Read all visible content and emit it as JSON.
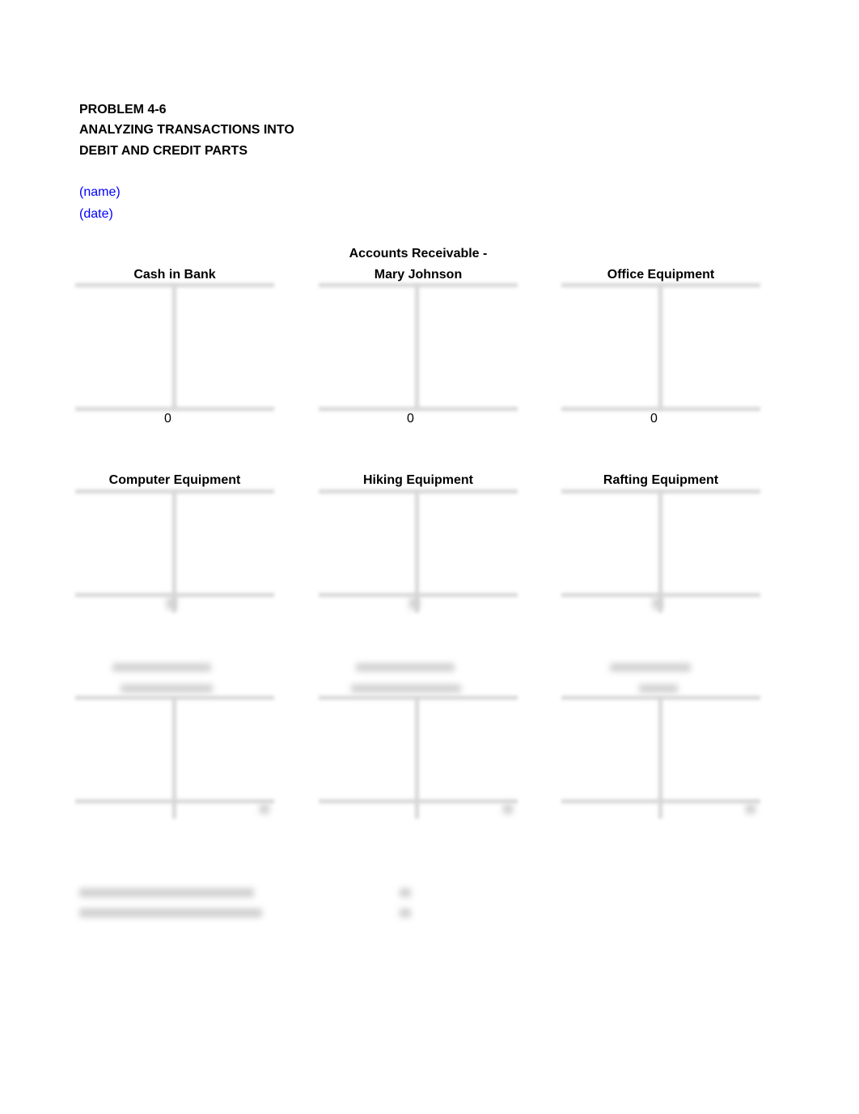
{
  "header": {
    "problem": "PROBLEM 4-6",
    "title_line1": "ANALYZING TRANSACTIONS INTO",
    "title_line2": "DEBIT AND CREDIT PARTS",
    "name_placeholder": "(name)",
    "date_placeholder": "(date)"
  },
  "accounts_row1": [
    {
      "title_line1": "",
      "title_line2": "Cash in Bank",
      "balance": "0"
    },
    {
      "title_line1": "Accounts Receivable -",
      "title_line2": "Mary Johnson",
      "balance": "0"
    },
    {
      "title_line1": "",
      "title_line2": "Office Equipment",
      "balance": "0"
    }
  ],
  "accounts_row2": [
    {
      "title": "Computer Equipment"
    },
    {
      "title": "Hiking Equipment"
    },
    {
      "title": "Rafting Equipment"
    }
  ],
  "accounts_row3": [
    {
      "title": "[blurred]"
    },
    {
      "title": "[blurred]"
    },
    {
      "title": "[blurred]"
    }
  ],
  "totals": {
    "note": "blurred content"
  },
  "colors": {
    "text": "#000000",
    "link_blue": "#0000ff",
    "t_account_line": "#d6d6d6"
  }
}
